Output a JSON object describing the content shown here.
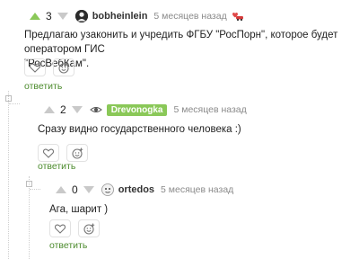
{
  "comments": [
    {
      "rating": "3",
      "author": "bobheinlein",
      "time": "5 месяцев назад",
      "text_line1": "Предлагаю узаконить и учредить ФГБУ \"РосПорн\", которое будет оператором ГИС",
      "text_line2": "\"РосВебКам\".",
      "reply_label": "ответить",
      "badge_icon": "heart-car-icon"
    },
    {
      "rating": "2",
      "author": "Drevonogka",
      "time": "5 месяцев назад",
      "text_line1": "Сразу видно государственного человека :)",
      "reply_label": "ответить"
    },
    {
      "rating": "0",
      "author": "ortedos",
      "time": "5 месяцев назад",
      "text_line1": "Ага, шарит )",
      "reply_label": "ответить"
    }
  ],
  "colors": {
    "accent_green": "#8ac858",
    "reply_green": "#4c8b2d",
    "muted_gray": "#8a8a8a"
  }
}
